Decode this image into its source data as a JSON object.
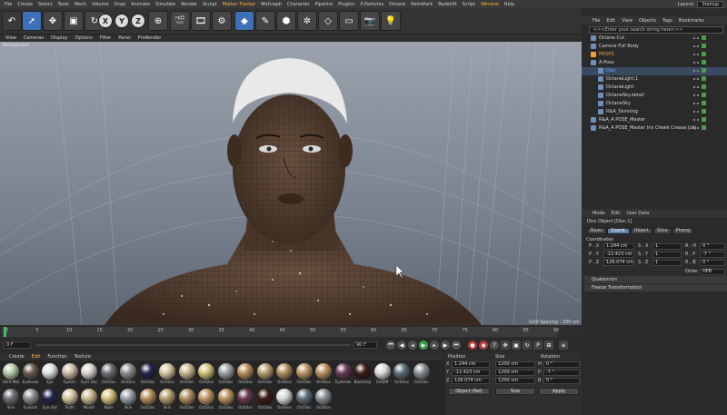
{
  "menubar": {
    "items": [
      "File",
      "Create",
      "Select",
      "Tools",
      "Mesh",
      "Volume",
      "Snap",
      "Animate",
      "Simulate",
      "Render",
      "Sculpt",
      "Motion Tracker",
      "MoGraph",
      "Character",
      "Pipeline",
      "Plugins",
      "X-Particles",
      "Octane",
      "RetroPark",
      "Redshift",
      "Script",
      "Window",
      "Help"
    ],
    "layout_label": "Layout:",
    "layout_value": "Startup"
  },
  "viewport": {
    "menu": [
      "View",
      "Cameras",
      "Display",
      "Options",
      "Filter",
      "Panel",
      "ProRender"
    ],
    "label": "Perspective",
    "grid_spacing": "Grid Spacing : 100 cm"
  },
  "timeline": {
    "frames": [
      "0",
      "5",
      "10",
      "15",
      "20",
      "25",
      "30",
      "35",
      "40",
      "45",
      "50",
      "55",
      "60",
      "65",
      "70",
      "75",
      "80",
      "85",
      "90"
    ],
    "start": "0 F",
    "end": "90 F",
    "current": "0 F"
  },
  "materials": {
    "menu": [
      "Create",
      "Edit",
      "Function",
      "Texture"
    ],
    "active_menu": "Edit",
    "row1": [
      "Glint Mat",
      "Eyebrow",
      "Eye",
      "Eye(n)",
      "Eyes Out",
      "OctGlos",
      "OctGlos",
      "OctGlos",
      "OctGlos",
      "OctGlos",
      "OctGlos",
      "OctGlos",
      "OctGlos",
      "OctGlos",
      "OctGlos",
      "OctGlos",
      "OctGlos",
      "Eyebrow",
      "Backdrop",
      "OctDiff",
      "OctGlos",
      "OctGlos"
    ],
    "row2": [
      "Skin",
      "Eyelash",
      "Eye Out",
      "Tooth",
      "Mouth",
      "Nails",
      "Skin",
      "OctGlos",
      "Skin",
      "OctGlos",
      "OctGlos",
      "OctGlos",
      "OctGlos",
      "OctGlos",
      "OctGlos",
      "OctGlos",
      "OctGlos"
    ]
  },
  "coordinates": {
    "headers": [
      "Position",
      "Size",
      "Rotation"
    ],
    "rows": [
      {
        "axis": "X",
        "pos": "1.244 cm",
        "size": "1200 cm",
        "rot_axis": "H",
        "rot": "0 °"
      },
      {
        "axis": "Y",
        "pos": "-12.423 cm",
        "size": "1200 cm",
        "rot_axis": "P",
        "rot": "-7 °"
      },
      {
        "axis": "Z",
        "pos": "126.074 cm",
        "size": "1200 cm",
        "rot_axis": "B",
        "rot": "0 °"
      }
    ],
    "mode": "Object (Rel)",
    "size_mode": "Size",
    "apply": "Apply"
  },
  "objects": {
    "menu": [
      "File",
      "Edit",
      "View",
      "Objects",
      "Tags",
      "Bookmarks"
    ],
    "search_placeholder": "<<<Enter your search string here>>>",
    "rows": [
      {
        "label": "Octane Cut",
        "color": "#d8d8d8",
        "indent": 0
      },
      {
        "label": "Camera Full Body",
        "color": "#d8d8d8",
        "indent": 0
      },
      {
        "label": "PROPS",
        "color": "#f0a030",
        "indent": 0
      },
      {
        "label": "A-Pose",
        "color": "#d8d8d8",
        "indent": 0
      },
      {
        "label": "Disc",
        "color": "#6fa8ff",
        "indent": 1
      },
      {
        "label": "OctaneLight.1",
        "color": "#d8d8d8",
        "indent": 1
      },
      {
        "label": "OctaneLight",
        "color": "#d8d8d8",
        "indent": 1
      },
      {
        "label": "OctaneSky.detail",
        "color": "#d8d8d8",
        "indent": 1
      },
      {
        "label": "OctaneSky",
        "color": "#d8d8d8",
        "indent": 1
      },
      {
        "label": "R&A_Skinning",
        "color": "#d8d8d8",
        "indent": 1
      },
      {
        "label": "R&A_A POSE_Master",
        "color": "#d8d8d8",
        "indent": 0
      },
      {
        "label": "R&A_A POSE_Master Iris Cheek Crease Jobj",
        "color": "#d8d8d8",
        "indent": 0
      }
    ]
  },
  "attributes": {
    "menu": [
      "Mode",
      "Edit",
      "User Data"
    ],
    "title": "Disc Object [Disc.1]",
    "tabs": [
      "Basic",
      "Coord.",
      "Object",
      "Slice",
      "Phong"
    ],
    "active_tab": "Coord.",
    "section": "Coordinates",
    "rows": [
      {
        "p": "P . X",
        "pv": "1.244 cm",
        "s": "S . X",
        "sv": "1",
        "r": "R . H",
        "rv": "0 °"
      },
      {
        "p": "P . Y",
        "pv": "-12.423 cm",
        "s": "S . Y",
        "sv": "1",
        "r": "R . P",
        "rv": "-7 °"
      },
      {
        "p": "P . Z",
        "pv": "126.074 cm",
        "s": "S . Z",
        "sv": "1",
        "r": "R . B",
        "rv": "0 °"
      }
    ],
    "order_label": "Order",
    "order_value": "HPB",
    "quaternion": "Quaternion",
    "freeze": "Freeze Transformation"
  },
  "colors": {
    "accent": "#ffb13a",
    "selection": "#5f7fa8"
  }
}
